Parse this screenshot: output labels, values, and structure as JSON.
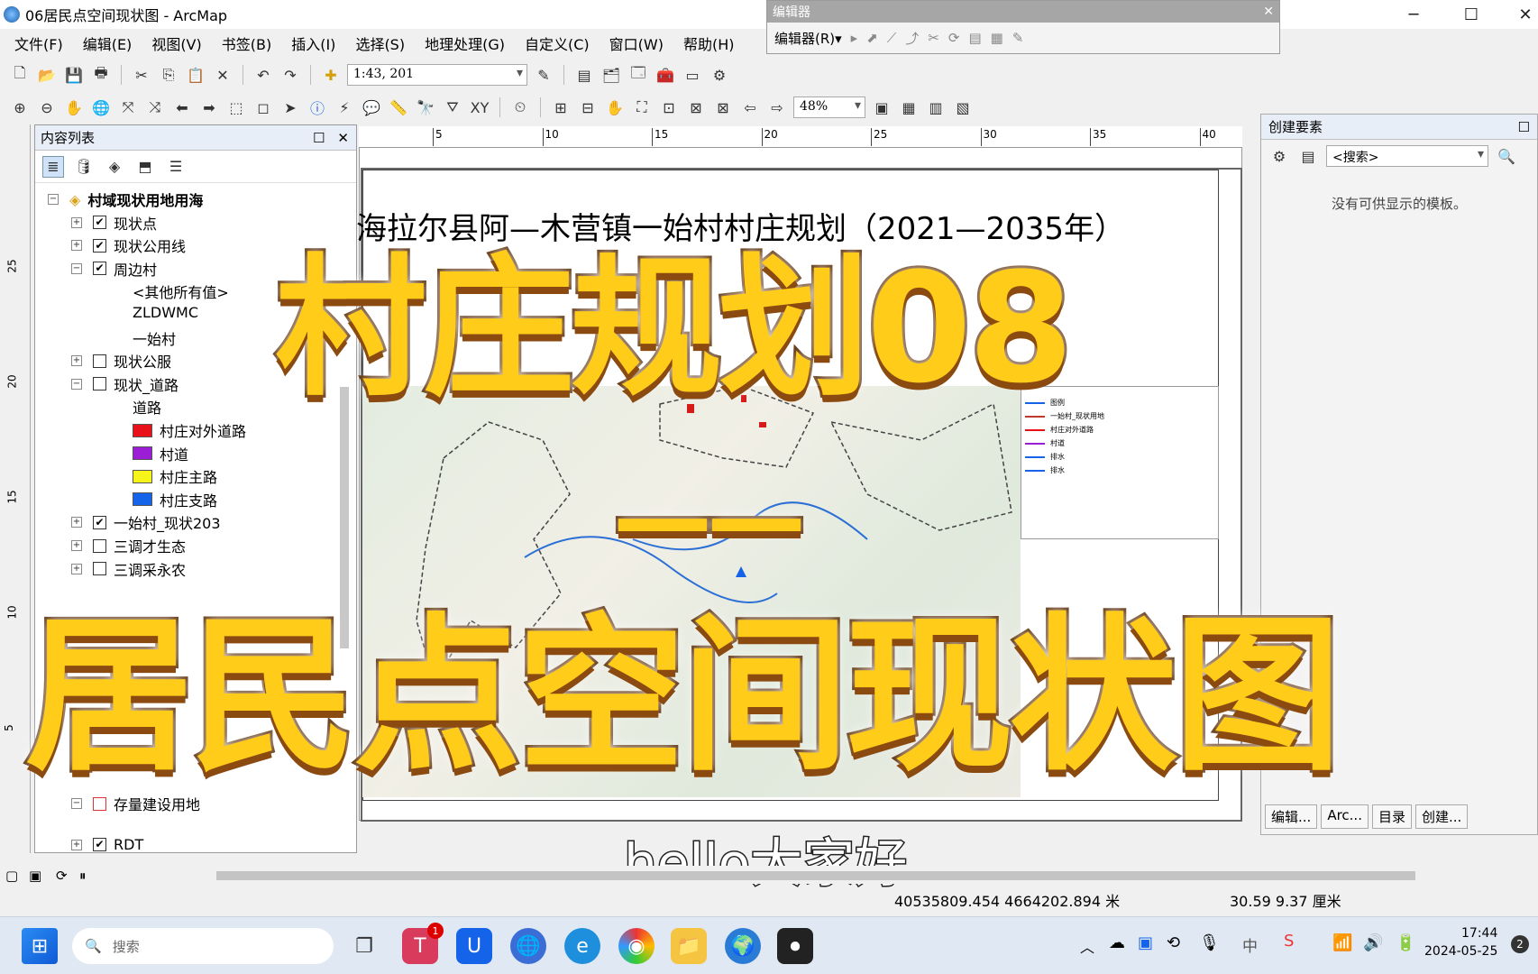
{
  "window": {
    "title": "06居民点空间现状图 - ArcMap",
    "min": "─",
    "max": "☐",
    "close": "✕"
  },
  "menu": [
    "文件(F)",
    "编辑(E)",
    "视图(V)",
    "书签(B)",
    "插入(I)",
    "选择(S)",
    "地理处理(G)",
    "自定义(C)",
    "窗口(W)",
    "帮助(H)"
  ],
  "toolbar": {
    "scale": "1:43, 201",
    "zoom": "48%"
  },
  "editor": {
    "title": "编辑器",
    "menu_label": "编辑器(R)▾"
  },
  "toc": {
    "title": "内容列表",
    "items": [
      {
        "label": "村域现状用地用海",
        "level": 0,
        "expander": "−",
        "bold": true
      },
      {
        "label": "现状点",
        "level": 1,
        "expander": "+",
        "checked": true
      },
      {
        "label": "现状公用线",
        "level": 1,
        "expander": "+",
        "checked": true
      },
      {
        "label": "周边村",
        "level": 1,
        "expander": "−",
        "checked": true
      },
      {
        "label": "<其他所有值>",
        "level": 2
      },
      {
        "label": "ZLDWMC",
        "level": 2
      },
      {
        "label": "一始村",
        "level": 2
      },
      {
        "label": "现状公服",
        "level": 1,
        "expander": "+",
        "checked": false
      },
      {
        "label": "现状_道路",
        "level": 1,
        "expander": "−",
        "checked": false
      },
      {
        "label": "道路",
        "level": 2
      },
      {
        "label": "村庄对外道路",
        "level": 2,
        "swatch": "#e8111a"
      },
      {
        "label": "村道",
        "level": 2,
        "swatch": "#9b1dd6"
      },
      {
        "label": "村庄主路",
        "level": 2,
        "swatch": "#f5f51a"
      },
      {
        "label": "村庄支路",
        "level": 2,
        "swatch": "#1463e8"
      },
      {
        "label": "一始村_现状203",
        "level": 1,
        "expander": "+",
        "checked": true
      },
      {
        "label": "三调才生态",
        "level": 1,
        "expander": "+",
        "checked": false
      },
      {
        "label": "三调采永农",
        "level": 1,
        "expander": "+",
        "checked": false
      }
    ],
    "lower_items": [
      {
        "label": "存量建设用地",
        "expander": "−",
        "checked": false
      },
      {
        "label": "RDT",
        "expander": "+",
        "checked": true
      }
    ],
    "partial_labels": [
      "范",
      "线",
      "§"
    ]
  },
  "ruler": [
    "5",
    "10",
    "15",
    "20",
    "25",
    "30",
    "35",
    "40"
  ],
  "vruler": [
    "25",
    "20",
    "15",
    "10",
    "5"
  ],
  "map": {
    "plan_title": "海拉尔县阿—木营镇一始村村庄规划（2021—2035年）",
    "legend": [
      "图例",
      "一始村_现状用地",
      "村庄对外道路",
      "村道",
      "排水",
      "排水"
    ],
    "legend_colors": [
      "#1463e8",
      "#c0392b",
      "#e8111a",
      "#9b1dd6",
      "#1463e8",
      "#1463e8"
    ]
  },
  "create_features": {
    "title": "创建要素",
    "search": "<搜索>",
    "empty_msg": "没有可供显示的模板。",
    "tabs": [
      "编辑...",
      "Arc...",
      "目录",
      "创建..."
    ]
  },
  "overlay": {
    "line1": "村庄规划08",
    "line2": "——",
    "line3": "居民点空间现状图",
    "subtitle": "hello大家好"
  },
  "status": {
    "coords": "40535809.454  4664202.894 米",
    "page": "30.59  9.37 厘米"
  },
  "taskbar": {
    "search": "搜索",
    "time": "17:44",
    "date": "2024-05-25",
    "ime": "中",
    "badge": "1",
    "notif": "2"
  }
}
